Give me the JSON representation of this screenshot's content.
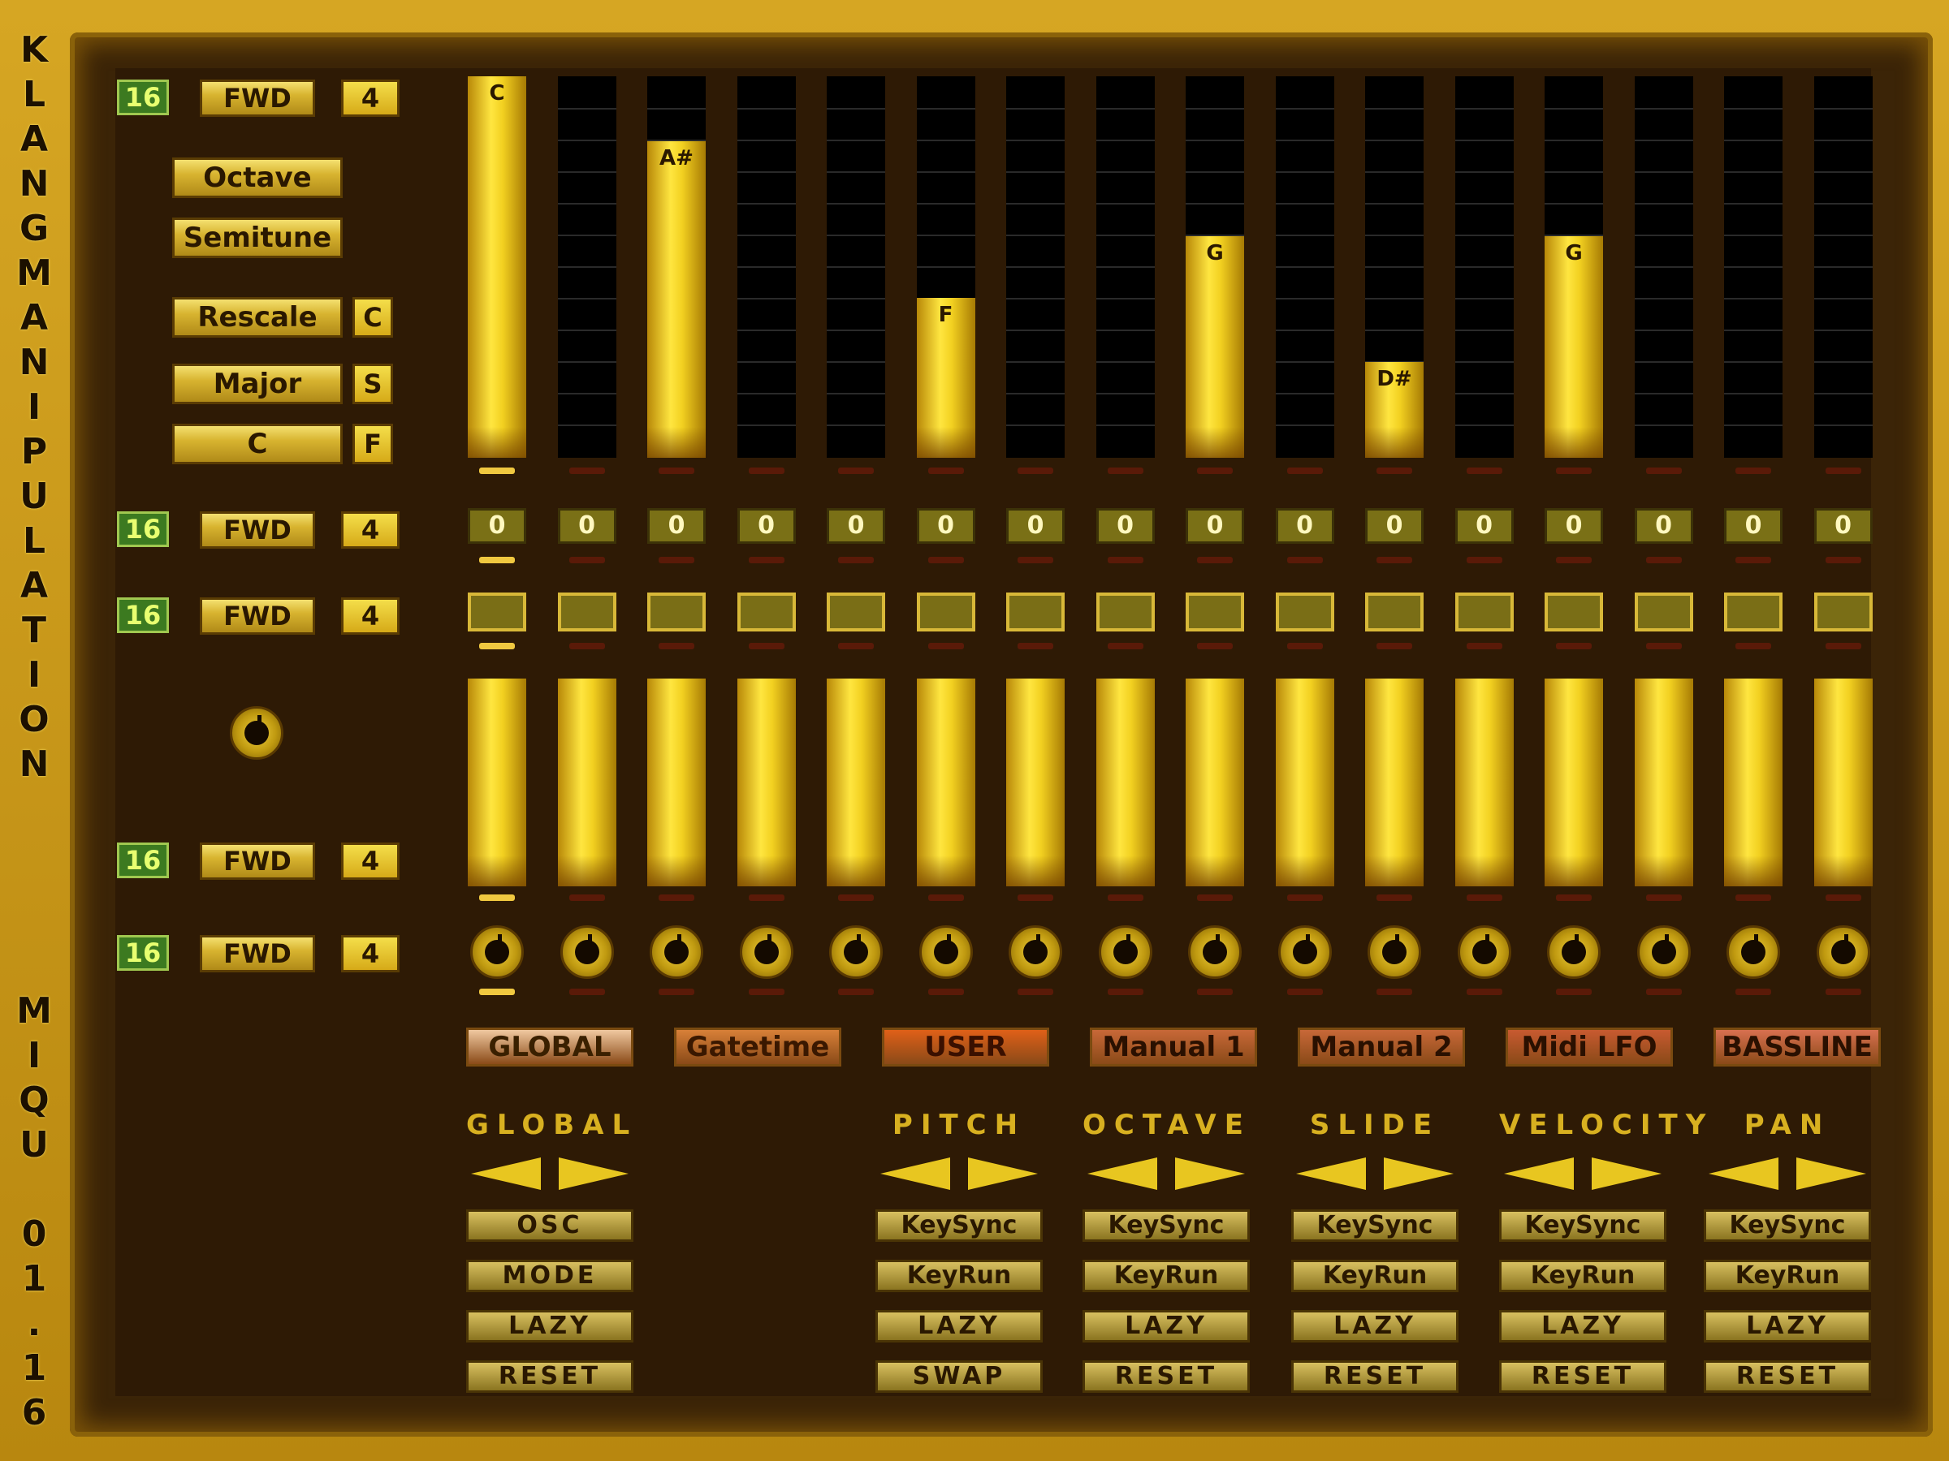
{
  "title_vertical": [
    "K",
    "L",
    "A",
    "N",
    "G",
    "M",
    "A",
    "N",
    "I",
    "P",
    "U",
    "L",
    "A",
    "T",
    "I",
    "O",
    "N"
  ],
  "author_vertical": [
    "M",
    "I",
    "Q",
    "U",
    " ",
    "0",
    "1",
    ".",
    "1",
    "6"
  ],
  "rows": [
    {
      "steps": "16",
      "direction": "FWD",
      "div": "4"
    },
    {
      "steps": "16",
      "direction": "FWD",
      "div": "4"
    },
    {
      "steps": "16",
      "direction": "FWD",
      "div": "4"
    },
    {
      "steps": "16",
      "direction": "FWD",
      "div": "4"
    },
    {
      "steps": "16",
      "direction": "FWD",
      "div": "4"
    }
  ],
  "pitch_controls": {
    "octave": "Octave",
    "semitune": "Semitune",
    "rescale": "Rescale",
    "rescale_tag": "C",
    "scale": "Major",
    "scale_tag": "S",
    "root": "C",
    "root_tag": "F"
  },
  "pitch_notes": [
    {
      "label": "C",
      "level": 1.0
    },
    {
      "label": "",
      "level": 0
    },
    {
      "label": "A#",
      "level": 0.83
    },
    {
      "label": "",
      "level": 0
    },
    {
      "label": "",
      "level": 0
    },
    {
      "label": "F",
      "level": 0.42
    },
    {
      "label": "",
      "level": 0
    },
    {
      "label": "",
      "level": 0
    },
    {
      "label": "G",
      "level": 0.58
    },
    {
      "label": "",
      "level": 0
    },
    {
      "label": "D#",
      "level": 0.25
    },
    {
      "label": "",
      "level": 0
    },
    {
      "label": "G",
      "level": 0.58
    },
    {
      "label": "",
      "level": 0
    },
    {
      "label": "",
      "level": 0
    },
    {
      "label": "",
      "level": 0
    }
  ],
  "octave_values": [
    "0",
    "0",
    "0",
    "0",
    "0",
    "0",
    "0",
    "0",
    "0",
    "0",
    "0",
    "0",
    "0",
    "0",
    "0",
    "0"
  ],
  "velocity_levels": [
    1,
    1,
    1,
    1,
    1,
    1,
    1,
    1,
    1,
    1,
    1,
    1,
    1,
    1,
    1,
    1
  ],
  "tabs": [
    {
      "label": "GLOBAL",
      "bg": "#f0c8a0",
      "fg": "#3a2000"
    },
    {
      "label": "Gatetime",
      "bg": "#d88038",
      "fg": "#3a1800"
    },
    {
      "label": "USER",
      "bg": "#e06018",
      "fg": "#3a1000"
    },
    {
      "label": "Manual 1",
      "bg": "#c86838",
      "fg": "#2a1000"
    },
    {
      "label": "Manual 2",
      "bg": "#c86838",
      "fg": "#2a1000"
    },
    {
      "label": "Midi LFO",
      "bg": "#c85a30",
      "fg": "#2a1000"
    },
    {
      "label": "BASSLINE",
      "bg": "#d87050",
      "fg": "#2a1000"
    }
  ],
  "sections": [
    {
      "label": "GLOBAL",
      "buttons": [
        "OSC",
        "MODE",
        "LAZY",
        "RESET"
      ]
    },
    {
      "label": "PITCH",
      "buttons": [
        "KeySync",
        "KeyRun",
        "LAZY",
        "SWAP"
      ]
    },
    {
      "label": "OCTAVE",
      "buttons": [
        "KeySync",
        "KeyRun",
        "LAZY",
        "RESET"
      ]
    },
    {
      "label": "SLIDE",
      "buttons": [
        "KeySync",
        "KeyRun",
        "LAZY",
        "RESET"
      ]
    },
    {
      "label": "VELOCITY",
      "buttons": [
        "KeySync",
        "KeyRun",
        "LAZY",
        "RESET"
      ]
    },
    {
      "label": "PAN",
      "buttons": [
        "KeySync",
        "KeyRun",
        "LAZY",
        "RESET"
      ]
    }
  ],
  "colors": {
    "gold": "#e8c620",
    "background": "#2e1a05",
    "frame": "#b88c10"
  }
}
